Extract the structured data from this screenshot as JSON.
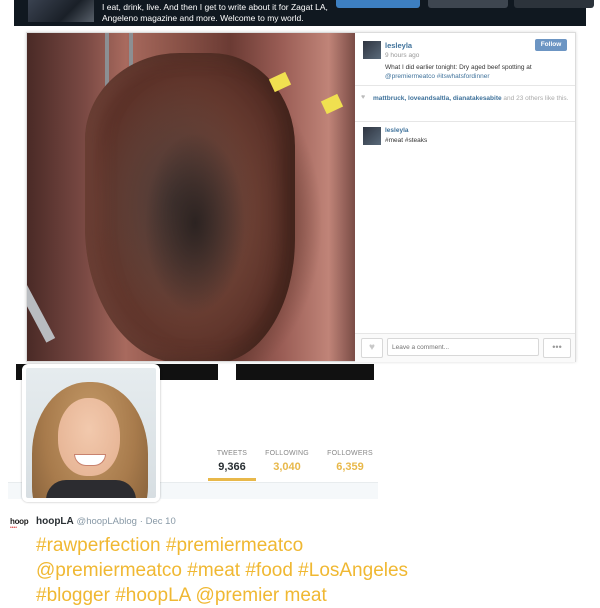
{
  "banner": {
    "bio_line1": "I eat, drink, live. And then I get to write about it for Zagat LA,",
    "bio_line2": "Angeleno magazine and more. Welcome to my world."
  },
  "instagram": {
    "username": "lesleyla",
    "follow_label": "Follow",
    "time_ago": "9 hours ago",
    "caption_text": "What I did earlier tonight: Dry aged beef spotting at",
    "caption_links": "@premiermeatco #itswhatsfordinner",
    "likers": "mattbruck, loveandsaltla, dianatakesabite",
    "likes_suffix": "and 23 others like this.",
    "comment_user": "lesleyla",
    "comment_text": "#meat #steaks",
    "comment_placeholder": "Leave a comment...",
    "more_label": "•••"
  },
  "profile": {
    "stats": [
      {
        "label": "TWEETS",
        "value": "9,366"
      },
      {
        "label": "FOLLOWING",
        "value": "3,040"
      },
      {
        "label": "FOLLOWERS",
        "value": "6,359"
      }
    ]
  },
  "tweet": {
    "logo_text": "hoop",
    "name": "hoopLA",
    "handle": "@hoopLAblog",
    "date": "Dec 10",
    "separator": "·",
    "line1": "#rawperfection #premiermeatco",
    "line2": "@premiermeatco #meat #food #LosAngeles",
    "line3": "#blogger #hoopLA @premier meat"
  },
  "colors": {
    "banner_bg": "#101820",
    "follow_blue": "#6c95c3",
    "link_blue": "#3f729b",
    "accent_gold": "#e8b84a",
    "tweet_text": "#f0b832"
  }
}
